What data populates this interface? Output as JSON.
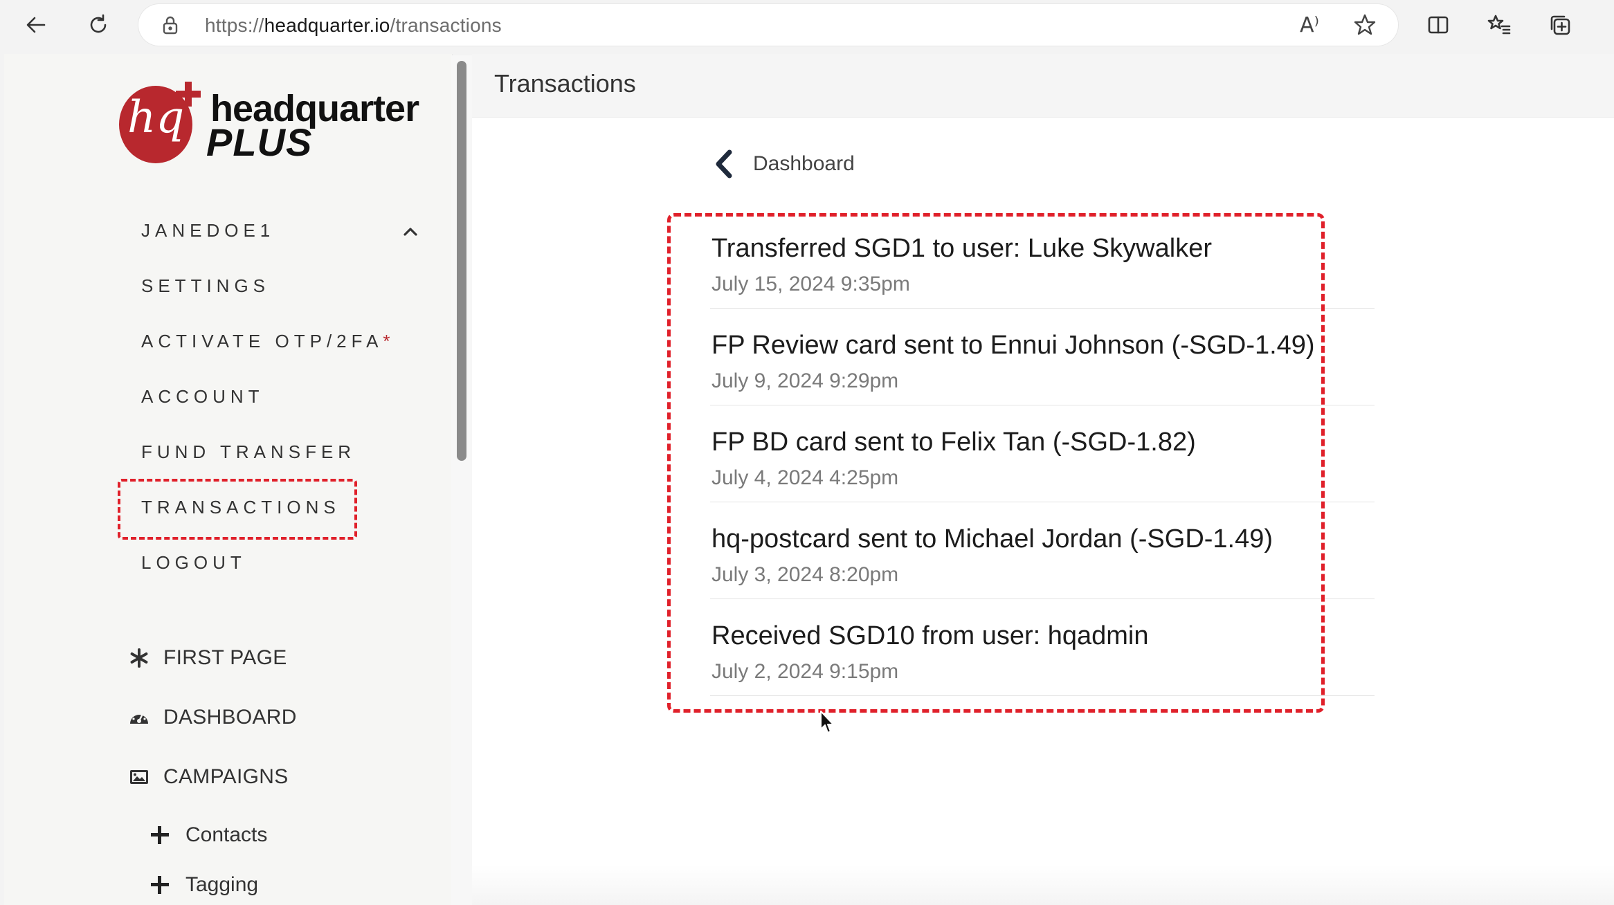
{
  "browser": {
    "url_prefix": "https://",
    "url_domain": "headquarter.io",
    "url_path": "/transactions",
    "read_aloud_label": "A⁾",
    "icons": [
      "back-arrow-icon",
      "refresh-icon",
      "lock-icon",
      "read-aloud-icon",
      "favorite-star-icon",
      "split-screen-icon",
      "favorites-list-icon",
      "collections-icon"
    ]
  },
  "logo": {
    "hq": "hq",
    "word": "headquarter",
    "plus": "PLUS"
  },
  "account_menu": {
    "username": "JANEDOE1",
    "items": [
      {
        "label": "SETTINGS"
      },
      {
        "label": "ACTIVATE OTP/2FA",
        "suffix": "*"
      },
      {
        "label": "ACCOUNT"
      },
      {
        "label": "FUND TRANSFER"
      },
      {
        "label": "TRANSACTIONS"
      },
      {
        "label": "LOGOUT"
      }
    ]
  },
  "nav": {
    "first_page": "FIRST PAGE",
    "dashboard": "DASHBOARD",
    "campaigns": "CAMPAIGNS",
    "contacts": "Contacts",
    "tagging": "Tagging"
  },
  "main": {
    "title": "Transactions",
    "back_label": "Dashboard",
    "transactions": [
      {
        "title": "Transferred SGD1 to user: Luke Skywalker",
        "date": "July 15, 2024 9:35pm"
      },
      {
        "title": "FP Review card sent to Ennui Johnson (-SGD-1.49)",
        "date": "July 9, 2024 9:29pm"
      },
      {
        "title": "FP BD card sent to Felix Tan (-SGD-1.82)",
        "date": "July 4, 2024 4:25pm"
      },
      {
        "title": "hq-postcard sent to Michael Jordan (-SGD-1.49)",
        "date": "July 3, 2024 8:20pm"
      },
      {
        "title": "Received SGD10 from user: hqadmin",
        "date": "July 2, 2024 9:15pm"
      }
    ]
  },
  "colors": {
    "brand_red": "#b8282e",
    "highlight_red": "#e0202a",
    "sidebar_bg": "#f6f6f4"
  }
}
